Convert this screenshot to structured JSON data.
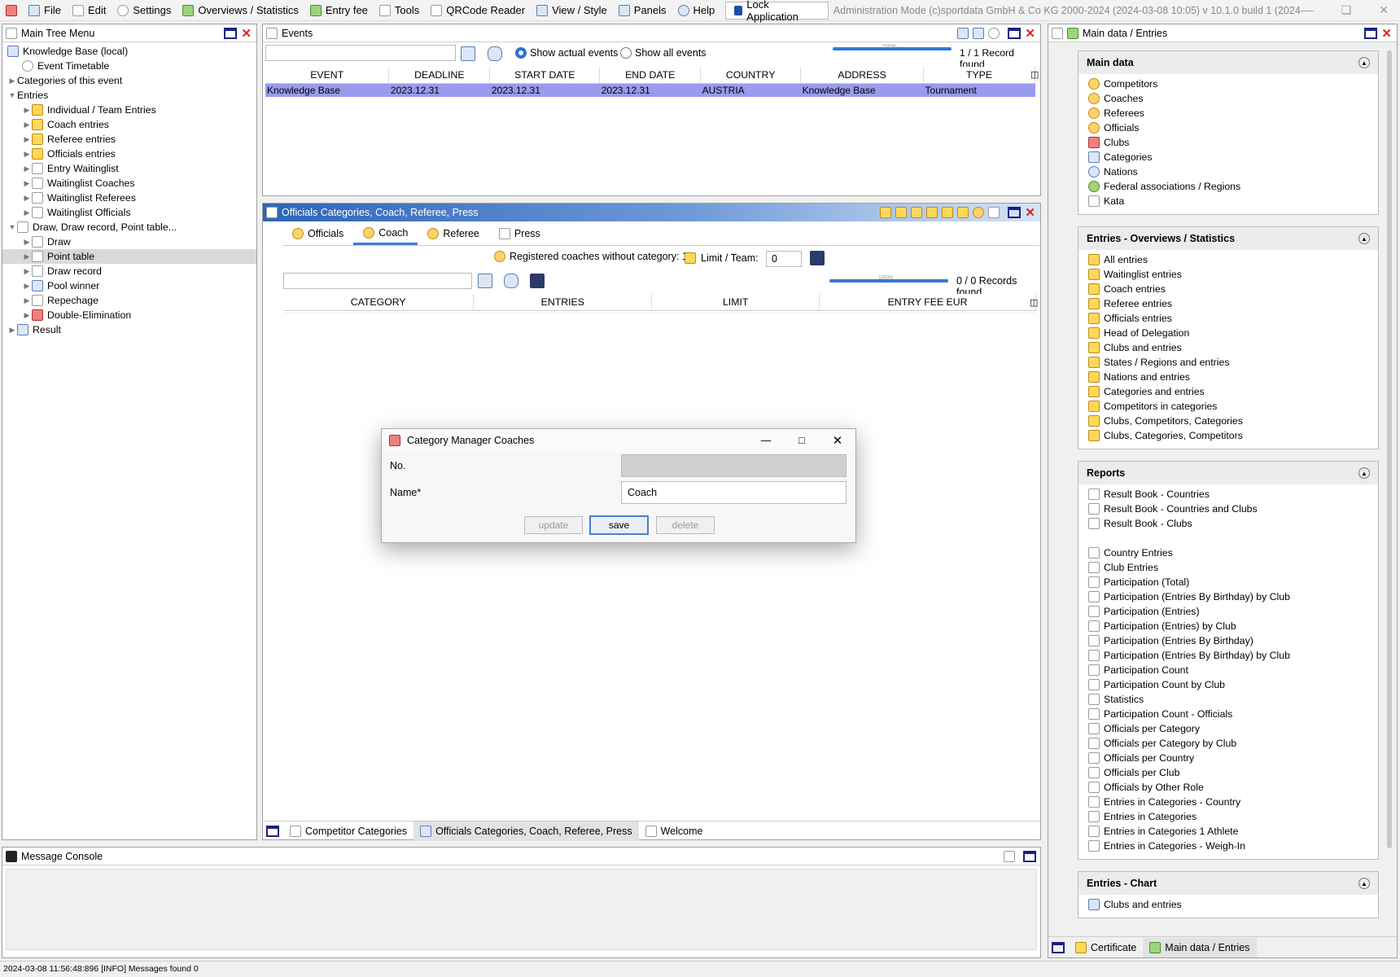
{
  "menu": {
    "file": "File",
    "edit": "Edit",
    "settings": "Settings",
    "overviews": "Overviews / Statistics",
    "entry_fee": "Entry fee",
    "tools": "Tools",
    "qrcode": "QRCode Reader",
    "view": "View / Style",
    "panels": "Panels",
    "help": "Help",
    "lock": "Lock Application",
    "mode_info": "Administration Mode (c)sportdata GmbH & Co KG 2000-2024 (2024-03-08 10:05)  v 10.1.0 build 1 (2024-01..."
  },
  "tree": {
    "title": "Main Tree Menu",
    "items": [
      {
        "label": "Knowledge Base (local)"
      },
      {
        "label": "Event Timetable"
      },
      {
        "label": "Categories of this event"
      },
      {
        "label": "Entries"
      },
      {
        "label": "Individual / Team Entries"
      },
      {
        "label": "Coach entries"
      },
      {
        "label": "Referee entries"
      },
      {
        "label": "Officials entries"
      },
      {
        "label": "Entry Waitinglist"
      },
      {
        "label": "Waitinglist Coaches"
      },
      {
        "label": "Waitinglist Referees"
      },
      {
        "label": "Waitinglist Officials"
      },
      {
        "label": "Draw, Draw record, Point table..."
      },
      {
        "label": "Draw"
      },
      {
        "label": "Point table"
      },
      {
        "label": "Draw record"
      },
      {
        "label": "Pool winner"
      },
      {
        "label": "Repechage"
      },
      {
        "label": "Double-Elimination"
      },
      {
        "label": "Result"
      }
    ]
  },
  "events": {
    "title": "Events",
    "radio_actual": "Show actual events",
    "radio_all": "Show all events",
    "progress_label": "100%",
    "records": "1 / 1 Record found",
    "columns": [
      "EVENT",
      "DEADLINE",
      "START DATE",
      "END DATE",
      "COUNTRY",
      "ADDRESS",
      "TYPE"
    ],
    "row": [
      "Knowledge Base",
      "2023.12.31",
      "2023.12.31",
      "2023.12.31",
      "AUSTRIA",
      "Knowledge Base",
      "Tournament"
    ]
  },
  "officials": {
    "title": "Officials Categories, Coach, Referee, Press",
    "tabs": [
      "Officials",
      "Coach",
      "Referee",
      "Press"
    ],
    "registered": "Registered coaches without category: 1",
    "limit_label": "Limit / Team:",
    "limit_value": "0",
    "progress_label": "100%",
    "records": "0 / 0 Records found",
    "columns": [
      "CATEGORY",
      "ENTRIES",
      "LIMIT",
      "ENTRY FEE EUR"
    ],
    "bottom_tabs": [
      "Competitor Categories",
      "Officials Categories, Coach, Referee, Press",
      "Welcome"
    ]
  },
  "dialog": {
    "title": "Category Manager Coaches",
    "no_label": "No.",
    "name_label": "Name*",
    "name_value": "Coach",
    "update": "update",
    "save": "save",
    "delete": "delete"
  },
  "right": {
    "title": "Main data / Entries",
    "main_data": {
      "header": "Main data",
      "items": [
        "Competitors",
        "Coaches",
        "Referees",
        "Officials",
        "Clubs",
        "Categories",
        "Nations",
        "Federal associations / Regions",
        "Kata"
      ]
    },
    "overviews": {
      "header": "Entries - Overviews / Statistics",
      "items": [
        "All entries",
        "Waitinglist entries",
        "Coach entries",
        "Referee entries",
        "Officials entries",
        "Head of Delegation",
        "Clubs and entries",
        "States / Regions and entries",
        "Nations and entries",
        "Categories and entries",
        "Competitors in categories",
        "Clubs, Competitors, Categories",
        "Clubs, Categories, Competitors"
      ]
    },
    "reports": {
      "header": "Reports",
      "items_a": [
        "Result Book - Countries",
        "Result Book - Countries and Clubs",
        "Result Book - Clubs"
      ],
      "items_b": [
        "Country Entries",
        "Club Entries",
        "Participation (Total)",
        "Participation (Entries By Birthday) by Club",
        "Participation (Entries)",
        "Participation (Entries) by Club",
        "Participation (Entries By Birthday)",
        "Participation (Entries By Birthday) by Club",
        "Participation Count",
        "Participation Count by Club",
        "Statistics",
        "Participation Count - Officials",
        "Officials per Category",
        "Officials per Category by Club",
        "Officials per Country",
        "Officials per Club",
        "Officials by Other Role",
        "Entries in Categories - Country",
        "Entries in Categories",
        "Entries in Categories 1 Athlete",
        "Entries in Categories - Weigh-In"
      ]
    },
    "chart": {
      "header": "Entries - Chart",
      "items": [
        "Clubs and entries"
      ]
    },
    "bottom_tabs": [
      "Certificate",
      "Main data / Entries"
    ]
  },
  "console": {
    "title": "Message Console"
  },
  "status": {
    "text": "2024-03-08 11:56:48:896 [INFO] Messages found 0"
  }
}
